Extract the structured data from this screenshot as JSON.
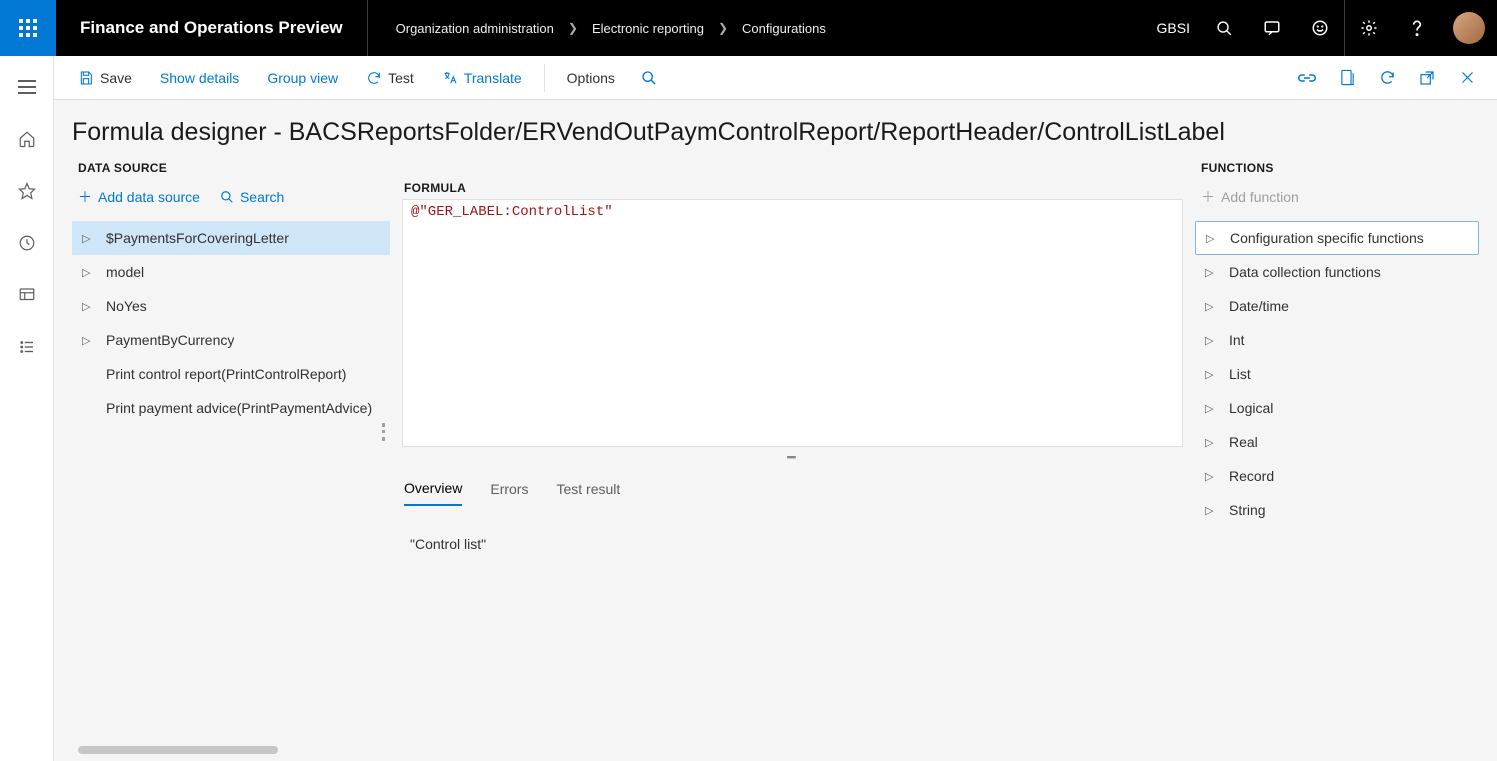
{
  "header": {
    "app_title": "Finance and Operations Preview",
    "breadcrumbs": [
      "Organization administration",
      "Electronic reporting",
      "Configurations"
    ],
    "company": "GBSI"
  },
  "actionbar": {
    "save": "Save",
    "show_details": "Show details",
    "group_view": "Group view",
    "test": "Test",
    "translate": "Translate",
    "options": "Options"
  },
  "page": {
    "title": "Formula designer - BACSReportsFolder/ERVendOutPaymControlReport/ReportHeader/ControlListLabel"
  },
  "datasource": {
    "section_label": "DATA SOURCE",
    "add_label": "Add data source",
    "search_label": "Search",
    "items": [
      {
        "label": "$PaymentsForCoveringLetter",
        "expandable": true,
        "selected": true
      },
      {
        "label": "model",
        "expandable": true
      },
      {
        "label": "NoYes",
        "expandable": true
      },
      {
        "label": "PaymentByCurrency",
        "expandable": true
      },
      {
        "label": "Print control report(PrintControlReport)",
        "expandable": false
      },
      {
        "label": "Print payment advice(PrintPaymentAdvice)",
        "expandable": false
      }
    ]
  },
  "formula": {
    "label": "FORMULA",
    "value": "@\"GER_LABEL:ControlList\""
  },
  "tabs": {
    "items": [
      "Overview",
      "Errors",
      "Test result"
    ],
    "active_index": 0,
    "overview_value": "\"Control list\""
  },
  "functions": {
    "section_label": "FUNCTIONS",
    "add_label": "Add function",
    "items": [
      {
        "label": "Configuration specific functions",
        "selected": true
      },
      {
        "label": "Data collection functions"
      },
      {
        "label": "Date/time"
      },
      {
        "label": "Int"
      },
      {
        "label": "List"
      },
      {
        "label": "Logical"
      },
      {
        "label": "Real"
      },
      {
        "label": "Record"
      },
      {
        "label": "String"
      }
    ]
  }
}
